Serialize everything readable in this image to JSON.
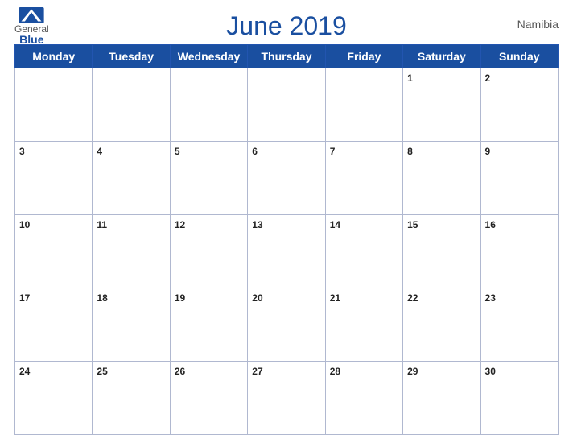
{
  "header": {
    "title": "June 2019",
    "country": "Namibia",
    "logo_general": "General",
    "logo_blue": "Blue"
  },
  "calendar": {
    "weekdays": [
      "Monday",
      "Tuesday",
      "Wednesday",
      "Thursday",
      "Friday",
      "Saturday",
      "Sunday"
    ],
    "weeks": [
      [
        null,
        null,
        null,
        null,
        null,
        1,
        2
      ],
      [
        3,
        4,
        5,
        6,
        7,
        8,
        9
      ],
      [
        10,
        11,
        12,
        13,
        14,
        15,
        16
      ],
      [
        17,
        18,
        19,
        20,
        21,
        22,
        23
      ],
      [
        24,
        25,
        26,
        27,
        28,
        29,
        30
      ]
    ]
  }
}
